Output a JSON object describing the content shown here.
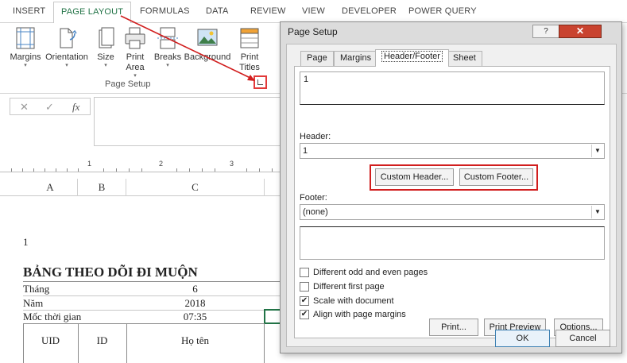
{
  "ribbon": {
    "tabs": [
      "INSERT",
      "PAGE LAYOUT",
      "FORMULAS",
      "DATA",
      "REVIEW",
      "VIEW",
      "DEVELOPER",
      "POWER QUERY"
    ],
    "active_tab": "PAGE LAYOUT",
    "buttons": {
      "margins": "Margins",
      "orientation": "Orientation",
      "size": "Size",
      "print_area_1": "Print",
      "print_area_2": "Area",
      "breaks": "Breaks",
      "background": "Background",
      "print_titles_1": "Print",
      "print_titles_2": "Titles"
    },
    "group_label": "Page Setup"
  },
  "formula_bar": {
    "cancel_icon": "✕",
    "enter_icon": "✓",
    "fx_icon": "fx"
  },
  "ruler": {
    "marks": [
      "1",
      "2",
      "3"
    ]
  },
  "columns": [
    "A",
    "B",
    "C"
  ],
  "sheet": {
    "header_text": "1",
    "title": "BẢNG THEO DÕI ĐI MUỘN",
    "rows": [
      {
        "label": "Tháng",
        "value": "6"
      },
      {
        "label": "Năm",
        "value": "2018"
      },
      {
        "label": "Mốc thời gian",
        "value": "07:35"
      }
    ],
    "table_headers": [
      "UID",
      "ID",
      "Họ tên"
    ]
  },
  "dialog": {
    "title": "Page Setup",
    "help_label": "?",
    "close_label": "✕",
    "tabs": [
      "Page",
      "Margins",
      "Header/Footer",
      "Sheet"
    ],
    "active_tab": "Header/Footer",
    "header_preview": "1",
    "header_label": "Header:",
    "header_value": "1",
    "custom_header_label": "Custom Header...",
    "custom_footer_label": "Custom Footer...",
    "footer_label": "Footer:",
    "footer_value": "(none)",
    "checkboxes": [
      {
        "label": "Different odd and even pages",
        "checked": false
      },
      {
        "label": "Different first page",
        "checked": false
      },
      {
        "label": "Scale with document",
        "checked": true
      },
      {
        "label": "Align with page margins",
        "checked": true
      }
    ],
    "print_label": "Print...",
    "print_preview_label": "Print Preview",
    "options_label": "Options...",
    "ok_label": "OK",
    "cancel_label": "Cancel"
  },
  "colors": {
    "accent_green": "#217346",
    "highlight_red": "#d11e1e",
    "close_red": "#c9432f"
  }
}
